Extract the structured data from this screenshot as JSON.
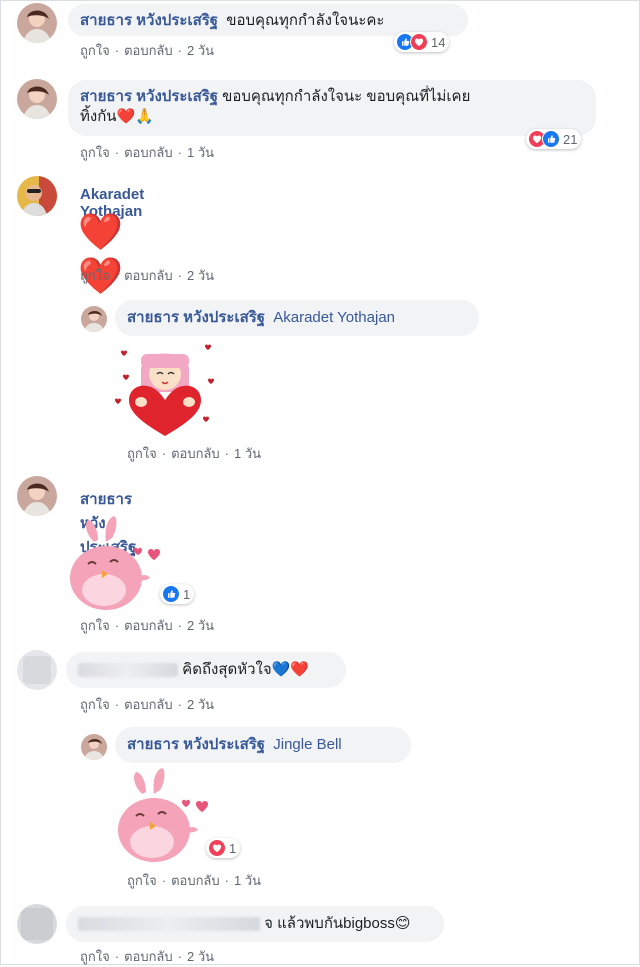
{
  "actions": {
    "like": "ถูกใจ",
    "reply": "ตอบกลับ",
    "sep": "·"
  },
  "comments": [
    {
      "name": "สายธาร หวังประเสริฐ",
      "text": "ขอบคุณทุกกำลังใจนะคะ",
      "time": "2 วัน",
      "reactions": [
        "like",
        "love"
      ],
      "reaction_count": "14"
    },
    {
      "name": "สายธาร หวังประเสริฐ",
      "text_line1": "ขอบคุณทุกกำลังใจนะ ขอบคุณที่ไม่เคย",
      "text_line2": "ทิ้งกัน❤️🙏",
      "time": "1 วัน",
      "reactions": [
        "love",
        "like"
      ],
      "reaction_count": "21"
    },
    {
      "name": "Akaradet Yothajan",
      "text": "❤️❤️",
      "time": "2 วัน"
    },
    {
      "name": "สายธาร หวังประเสริฐ",
      "mention": "Akaradet Yothajan",
      "time": "1 วัน",
      "sticker": "girl-heart-sticker"
    },
    {
      "name": "สายธาร หวังประเสริฐ",
      "time": "2 วัน",
      "sticker": "pink-bird-sticker",
      "reactions": [
        "like"
      ],
      "reaction_count": "1"
    },
    {
      "name": "",
      "text": "คิดถึงสุดหัวใจ💙❤️",
      "time": "2 วัน",
      "blurred_name": true
    },
    {
      "name": "สายธาร หวังประเสริฐ",
      "mention": "Jingle Bell",
      "time": "1 วัน",
      "sticker": "pink-bird-sticker",
      "reactions": [
        "love"
      ],
      "reaction_count": "1"
    },
    {
      "name": "",
      "text": "จ แล้วพบกันbigboss😊",
      "time": "2 วัน",
      "blurred_name": true
    }
  ],
  "colors": {
    "name": "#385898",
    "meta": "#606770",
    "bubble": "#f2f3f5",
    "like": "#1877f2",
    "love": "#f33e58"
  }
}
